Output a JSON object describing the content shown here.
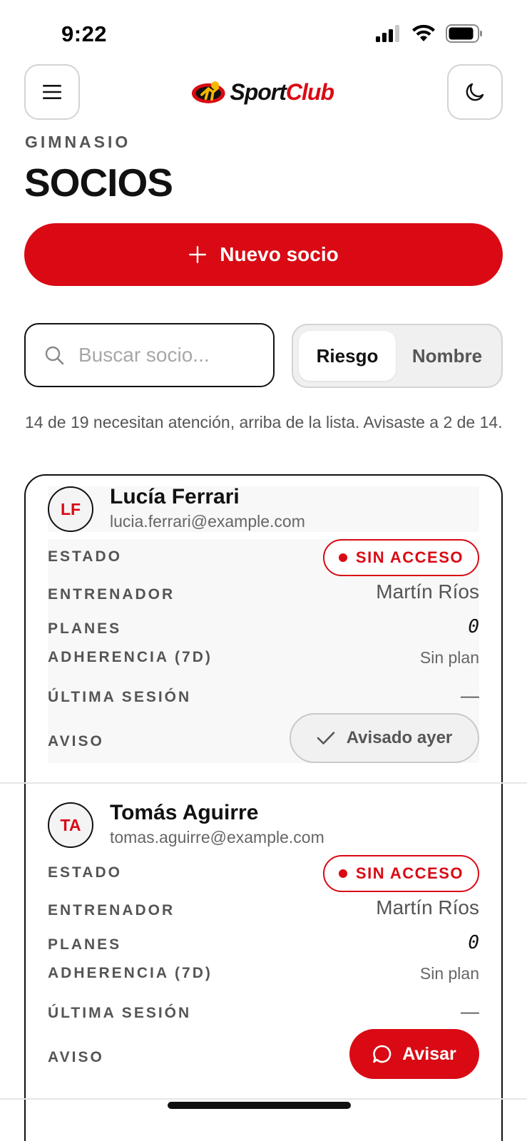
{
  "status_bar": {
    "time": "9:22"
  },
  "header": {
    "menu_icon": "hamburger-icon",
    "theme_icon": "moon-icon",
    "logo": {
      "text_sport": "Sport",
      "text_club": "Club"
    }
  },
  "page": {
    "eyebrow": "GIMNASIO",
    "title": "SOCIOS",
    "new_member_label": "Nuevo socio"
  },
  "search": {
    "placeholder": "Buscar socio..."
  },
  "sort": {
    "options": [
      "Riesgo",
      "Nombre"
    ],
    "selected": "Riesgo"
  },
  "summary": "14 de 19 necesitan atención, arriba de la lista. Avisaste a 2 de 14.",
  "labels": {
    "status": "ESTADO",
    "trainer": "ENTRENADOR",
    "plans": "PLANES",
    "adherence": "ADHERENCIA (7D)",
    "last_session": "ÚLTIMA SESIÓN",
    "notice": "AVISO"
  },
  "members": [
    {
      "initials": "LF",
      "name": "Lucía Ferrari",
      "email": "lucia.ferrari@example.com",
      "status": "SIN ACCESO",
      "trainer": "Martín Ríos",
      "plans": "0",
      "adherence": "Sin plan",
      "last_session": "—",
      "notice_label": "Avisado ayer",
      "notice_state": "notified"
    },
    {
      "initials": "TA",
      "name": "Tomás Aguirre",
      "email": "tomas.aguirre@example.com",
      "status": "SIN ACCESO",
      "trainer": "Martín Ríos",
      "plans": "0",
      "adherence": "Sin plan",
      "last_session": "—",
      "notice_label": "Avisar",
      "notice_state": "pending"
    }
  ],
  "colors": {
    "accent": "#d90a14",
    "text": "#111111",
    "muted": "#555555",
    "border": "#d3d3d3"
  }
}
